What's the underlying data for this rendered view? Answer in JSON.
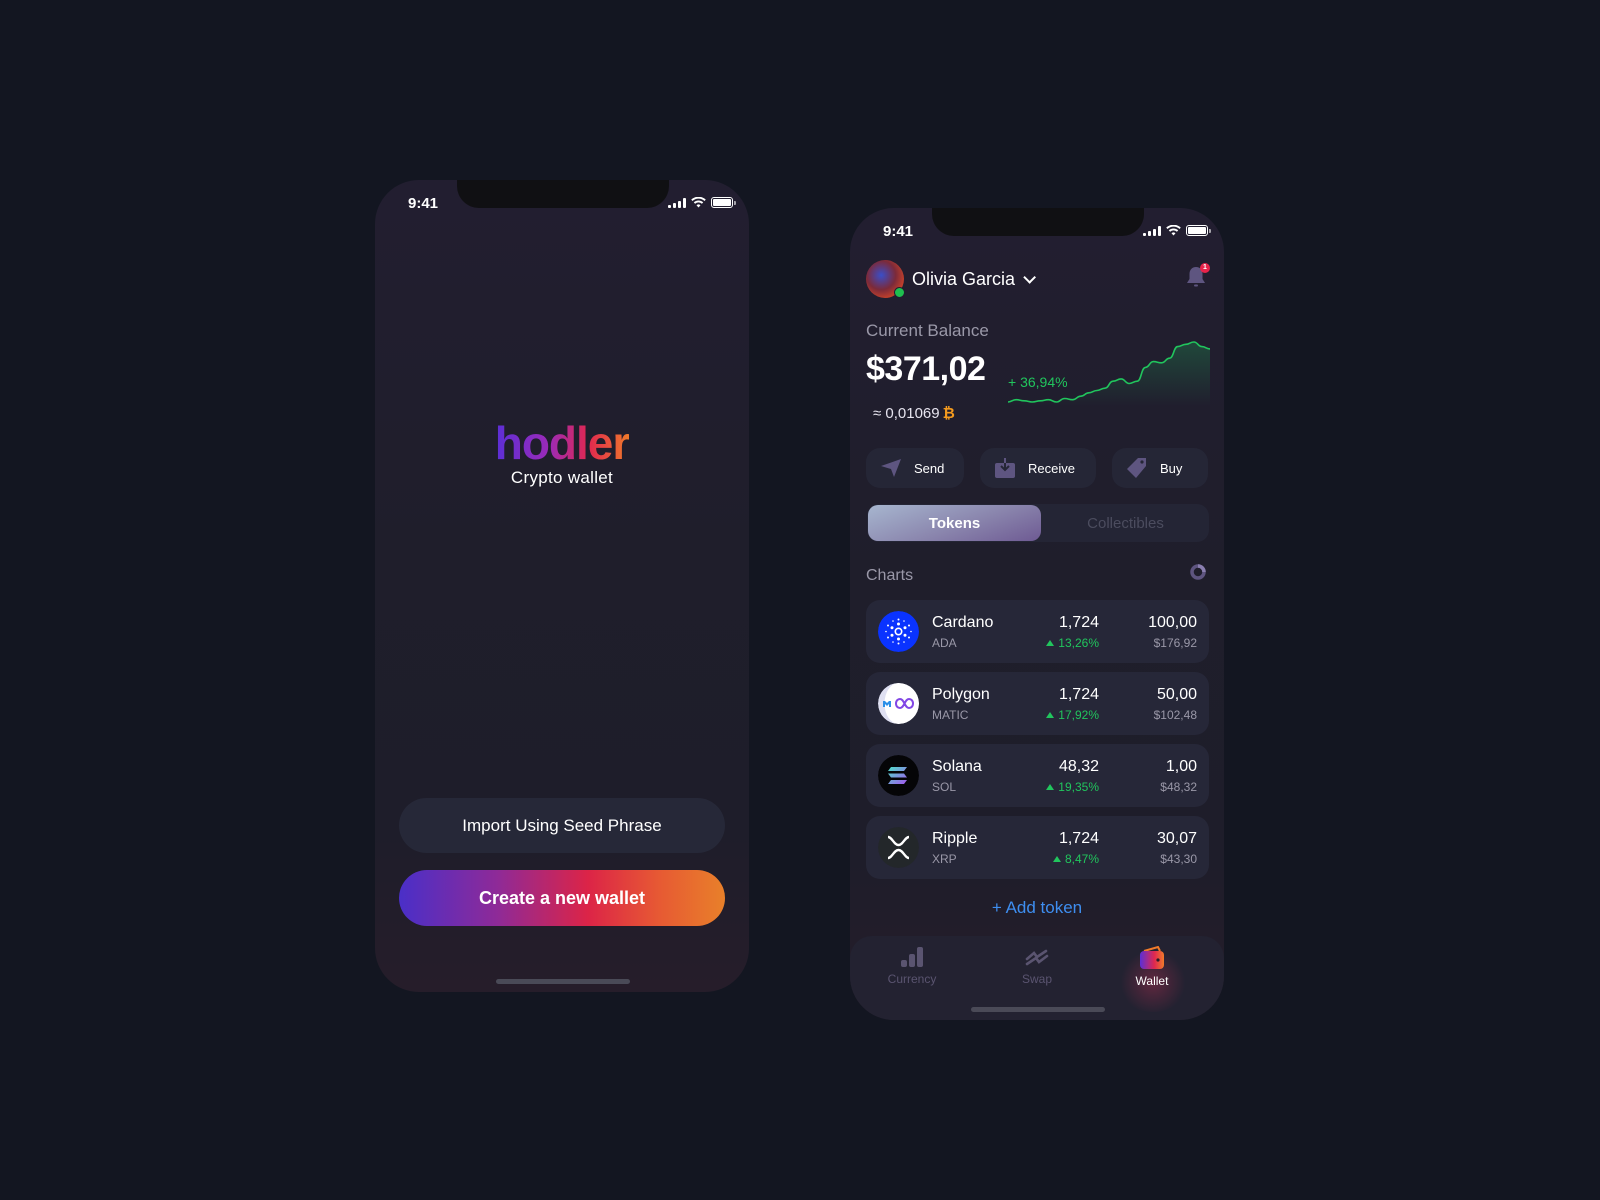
{
  "onboarding": {
    "status_time": "9:41",
    "logo": "hodler",
    "tagline": "Crypto wallet",
    "import_button": "Import Using Seed Phrase",
    "create_button": "Create a new wallet"
  },
  "wallet": {
    "status_time": "9:41",
    "user_name": "Olivia Garcia",
    "notification_count": "1",
    "balance_label": "Current Balance",
    "balance_value": "$371,02",
    "balance_btc": "≈ 0,01069",
    "btc_symbol": "₿",
    "balance_change": "+ 36,94%",
    "actions": [
      {
        "label": "Send",
        "icon": "send-icon"
      },
      {
        "label": "Receive",
        "icon": "receive-icon"
      },
      {
        "label": "Buy",
        "icon": "tag-icon"
      }
    ],
    "segments": {
      "active": "Tokens",
      "inactive": "Collectibles"
    },
    "charts_label": "Charts",
    "tokens": [
      {
        "name": "Cardano",
        "symbol": "ADA",
        "price": "1,724",
        "change": "13,26%",
        "amount": "100,00",
        "usd": "$176,92"
      },
      {
        "name": "Polygon",
        "symbol": "MATIC",
        "price": "1,724",
        "change": "17,92%",
        "amount": "50,00",
        "usd": "$102,48"
      },
      {
        "name": "Solana",
        "symbol": "SOL",
        "price": "48,32",
        "change": "19,35%",
        "amount": "1,00",
        "usd": "$48,32"
      },
      {
        "name": "Ripple",
        "symbol": "XRP",
        "price": "1,724",
        "change": "8,47%",
        "amount": "30,07",
        "usd": "$43,30"
      }
    ],
    "add_token": "+ Add token",
    "tabs": [
      {
        "label": "Currency",
        "icon": "bar-chart-icon",
        "active": false
      },
      {
        "label": "Swap",
        "icon": "swap-icon",
        "active": false
      },
      {
        "label": "Wallet",
        "icon": "wallet-icon",
        "active": true
      }
    ],
    "sparkline_values": [
      10,
      12,
      11,
      10,
      11,
      12,
      10,
      13,
      12,
      15,
      18,
      20,
      22,
      28,
      30,
      26,
      28,
      40,
      45,
      44,
      48,
      58,
      60,
      62,
      58,
      56
    ]
  },
  "colors": {
    "background": "#131621",
    "accent_green": "#21c55d",
    "link_blue": "#3e8ef0",
    "btc_orange": "#f39a1e",
    "badge_red": "#e8234a"
  }
}
